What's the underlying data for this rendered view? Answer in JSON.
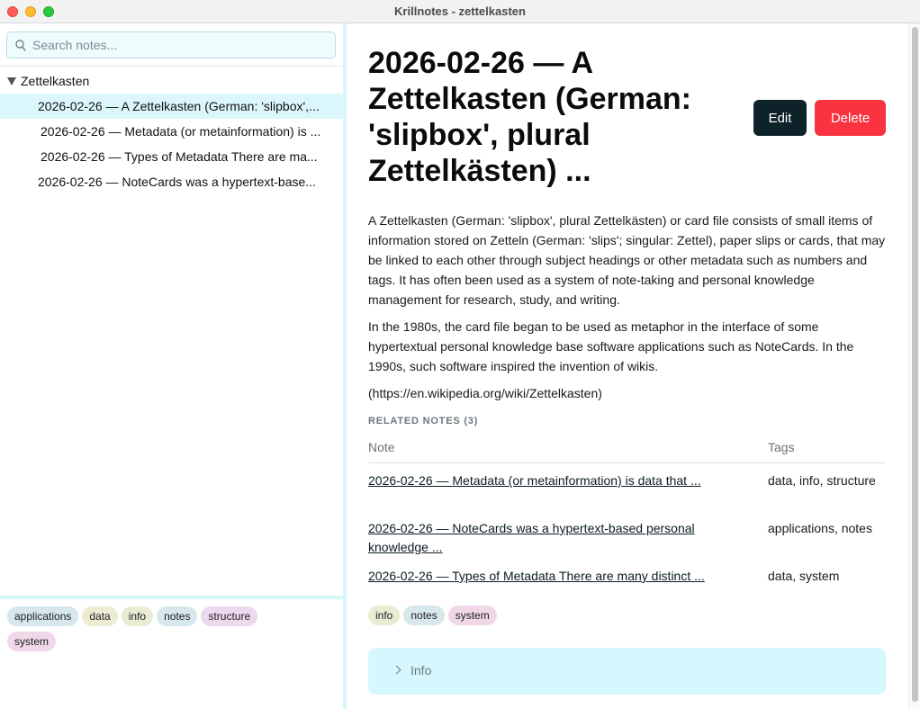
{
  "window": {
    "title": "Krillnotes - zettelkasten"
  },
  "search": {
    "placeholder": "Search notes..."
  },
  "tree": {
    "root_label": "Zettelkasten",
    "items": [
      {
        "label": "2026-02-26 — A Zettelkasten (German: 'slipbox',...",
        "selected": true
      },
      {
        "label": "2026-02-26 — Metadata (or metainformation) is ..."
      },
      {
        "label": "2026-02-26 — Types of Metadata There are ma..."
      },
      {
        "label": "2026-02-26 — NoteCards was a hypertext-base..."
      }
    ]
  },
  "sidebar_tags": [
    {
      "label": "applications",
      "color": "#d6e7ee"
    },
    {
      "label": "data",
      "color": "#ecebd4"
    },
    {
      "label": "info",
      "color": "#e8ecd3"
    },
    {
      "label": "notes",
      "color": "#d7e8ec"
    },
    {
      "label": "structure",
      "color": "#ecd9ee"
    },
    {
      "label": "system",
      "color": "#f1d8e8"
    }
  ],
  "note": {
    "title": "2026-02-26 — A Zettelkasten (German: 'slipbox', plural Zettelkästen) ...",
    "edit_label": "Edit",
    "delete_label": "Delete",
    "paragraphs": [
      "A Zettelkasten (German: 'slipbox', plural Zettelkästen) or card file consists of small items of information stored on Zetteln (German: 'slips'; singular: Zettel), paper slips or cards, that may be linked to each other through subject headings or other metadata such as numbers and tags. It has often been used as a system of note-taking and personal knowledge management for research, study, and writing.",
      "In the 1980s, the card file began to be used as metaphor in the interface of some hypertextual personal knowledge base software applications such as NoteCards. In the 1990s, such software inspired the invention of wikis.",
      "(https://en.wikipedia.org/wiki/Zettelkasten)"
    ],
    "related_heading": "RELATED NOTES (3)",
    "related_columns": {
      "note": "Note",
      "tags": "Tags"
    },
    "related": [
      {
        "note": "2026-02-26 — Metadata (or metainformation) is data that ...",
        "tags": "data, info, structure"
      },
      {
        "note": "2026-02-26 — NoteCards was a hypertext-based personal knowledge ...",
        "tags": "applications, notes"
      },
      {
        "note": "2026-02-26 — Types of Metadata There are many distinct ...",
        "tags": "data, system"
      }
    ],
    "tags": [
      {
        "label": "info",
        "color": "#e8ecd3"
      },
      {
        "label": "notes",
        "color": "#d7e8ec"
      },
      {
        "label": "system",
        "color": "#f1d8e8"
      }
    ],
    "info_label": "Info"
  }
}
